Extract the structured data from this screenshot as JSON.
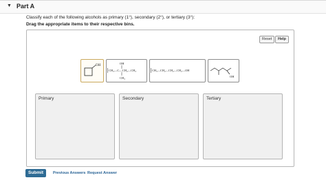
{
  "part": {
    "title": "Part A",
    "caret_icon": "triangle-down-icon"
  },
  "question": "Classify each of the following alcohols as primary (1°), secondary (2°), or tertiary (3°):",
  "instruction": "Drag the appropriate items to their respective bins.",
  "buttons": {
    "reset": "Reset",
    "help": "Help"
  },
  "items": [
    {
      "id": "cyclobutylmethanol",
      "oh": "OH"
    },
    {
      "id": "2-methyl-2-butanol",
      "top": "OH",
      "chain": "CH₃—C—CH₂—CH₃",
      "bottom": "CH₃",
      "left_group": "CH₃",
      "mid": "C",
      "right_groups": "CH₂—CH₃"
    },
    {
      "id": "1-pentanol",
      "formula": "CH₃—CH₂—CH₂—CH₂—OH"
    },
    {
      "id": "4-methyl-2-pentanol",
      "oh": "OH"
    }
  ],
  "bins": [
    {
      "label": "Primary"
    },
    {
      "label": "Secondary"
    },
    {
      "label": "Tertiary"
    }
  ],
  "footer": {
    "submit": "Submit",
    "previous_answers": "Previous Answers",
    "request_answer": "Request Answer"
  },
  "colors": {
    "submit_bg": "#2e6b94",
    "link": "#2a6496",
    "bin_bg": "#f0f0f0",
    "selected_tile_border": "#c9a85c"
  }
}
